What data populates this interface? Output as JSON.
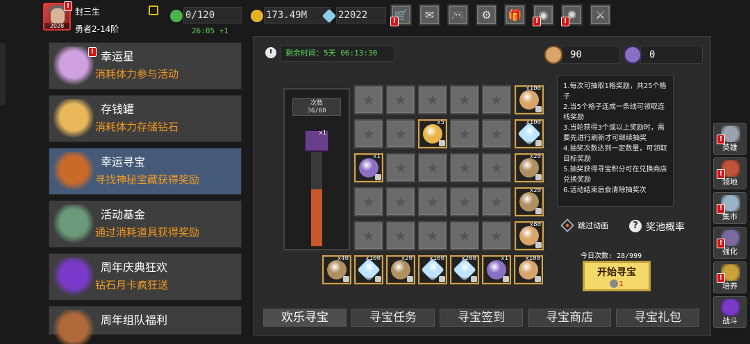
{
  "player": {
    "name": "封三生",
    "level_badge": "2028",
    "rank": "勇者2-14阶"
  },
  "resources": {
    "stamina": "0/120",
    "stamina_timer": "26:05 +1",
    "gold": "173.49M",
    "diamonds": "22022"
  },
  "top_buttons": [
    {
      "name": "shop",
      "icon": "cart-icon",
      "glyph": "🛒",
      "alert": true
    },
    {
      "name": "mail",
      "icon": "mail-icon",
      "glyph": "✉",
      "alert": false
    },
    {
      "name": "gamepad",
      "icon": "gamepad-icon",
      "glyph": "🎮",
      "alert": false
    },
    {
      "name": "settings",
      "icon": "gear-icon",
      "glyph": "⚙",
      "alert": false
    },
    {
      "name": "gift",
      "icon": "gift-icon",
      "glyph": "🎁",
      "alert": false
    },
    {
      "name": "wheel",
      "icon": "color-wheel-icon",
      "glyph": "◉",
      "alert": true
    },
    {
      "name": "firework",
      "icon": "firework-icon",
      "glyph": "✺",
      "alert": true
    },
    {
      "name": "battle",
      "icon": "crossed-swords-icon",
      "glyph": "⚔",
      "alert": false
    }
  ],
  "sidebar": [
    {
      "title": "幸运星",
      "subtitle": "消耗体力参与活动",
      "icon": "lucky-star-icon",
      "alert": true,
      "active": false
    },
    {
      "title": "存钱罐",
      "subtitle": "消耗体力存储钻石",
      "icon": "piggy-bank-icon",
      "alert": false,
      "active": false
    },
    {
      "title": "幸运寻宝",
      "subtitle": "寻找神秘宝藏获得奖励",
      "icon": "treasure-chest-icon",
      "alert": false,
      "active": true
    },
    {
      "title": "活动基金",
      "subtitle": "通过消耗道具获得奖励",
      "icon": "fund-bag-icon",
      "alert": false,
      "active": false
    },
    {
      "title": "周年庆典狂欢",
      "subtitle": "钻石月卡疯狂送",
      "icon": "celebration-gem-icon",
      "alert": false,
      "active": false
    },
    {
      "title": "周年组队福利",
      "subtitle": "",
      "icon": "team-chest-icon",
      "alert": false,
      "active": false
    }
  ],
  "main": {
    "remaining_label": "剩余时间：",
    "remaining_value": "5天 06:13:30",
    "currency_a": "90",
    "currency_b": "0",
    "count_label": "次数",
    "count_value": "36/60",
    "progress_fraction": 0.6,
    "chest_qty": "x1",
    "rules": "1.每次可抽取1格奖励，共25个格子\n2.当5个格子连成一条线可领取连线奖励\n3.当轮获得3个或以上奖励时，需要先进行刷新才可继续抽奖\n4.抽奖次数达到一定数量，可领取目标奖励\n5.抽奖获得寻宝积分可在兑换商店兑换奖励\n6.活动结束后会清除抽奖次",
    "skip_label": "跳过动画",
    "pool_label": "奖池概率",
    "today_label": "今日次数: 28/999",
    "start_label": "开始寻宝",
    "start_cost": "1"
  },
  "grid": {
    "revealed": [
      {
        "row": 1,
        "col": 2,
        "item": "golden-egg-icon",
        "qty": "x5",
        "color": "#e9b64a"
      },
      {
        "row": 2,
        "col": 0,
        "item": "rainbow-orb-icon",
        "qty": "x1",
        "color": "#8a6fc4"
      }
    ],
    "right_column": [
      {
        "item": "biscuit-icon",
        "qty": "x100",
        "color": "#d7a56a"
      },
      {
        "item": "diamond-icon",
        "qty": "x100",
        "color": "#bfe4ff"
      },
      {
        "item": "hammer-icon",
        "qty": "x20",
        "color": "#b09060"
      },
      {
        "item": "hammer-icon",
        "qty": "x20",
        "color": "#b09060"
      },
      {
        "item": "biscuit-icon",
        "qty": "x80",
        "color": "#d7a56a"
      }
    ],
    "bottom_row": [
      {
        "item": "hammer-icon",
        "qty": "x40",
        "color": "#b09060"
      },
      {
        "item": "diamond-icon",
        "qty": "x100",
        "color": "#bfe4ff"
      },
      {
        "item": "hammer-icon",
        "qty": "x20",
        "color": "#b09060"
      },
      {
        "item": "diamond-icon",
        "qty": "x100",
        "color": "#bfe4ff"
      },
      {
        "item": "diamond-icon",
        "qty": "x200",
        "color": "#bfe4ff"
      },
      {
        "item": "rainbow-orb-icon",
        "qty": "x1",
        "color": "#8a6fc4"
      },
      {
        "item": "biscuit-icon",
        "qty": "x100",
        "color": "#d7a56a"
      }
    ]
  },
  "tabs": [
    "欢乐寻宝",
    "寻宝任务",
    "寻宝签到",
    "寻宝商店",
    "寻宝礼包"
  ],
  "right_nav": [
    {
      "label": "英雄",
      "icon": "helmet-icon",
      "alert": true,
      "color": "#9aa4b0"
    },
    {
      "label": "领地",
      "icon": "castle-icon",
      "alert": true,
      "color": "#c0543a"
    },
    {
      "label": "集市",
      "icon": "market-icon",
      "alert": true,
      "color": "#9ab3c8"
    },
    {
      "label": "强化",
      "icon": "anvil-icon",
      "alert": true,
      "color": "#7a6aa0"
    },
    {
      "label": "培养",
      "icon": "trophy-icon",
      "alert": true,
      "color": "#c9a23a"
    },
    {
      "label": "战斗",
      "icon": "portal-icon",
      "alert": false,
      "color": "#7a3ac9"
    }
  ]
}
